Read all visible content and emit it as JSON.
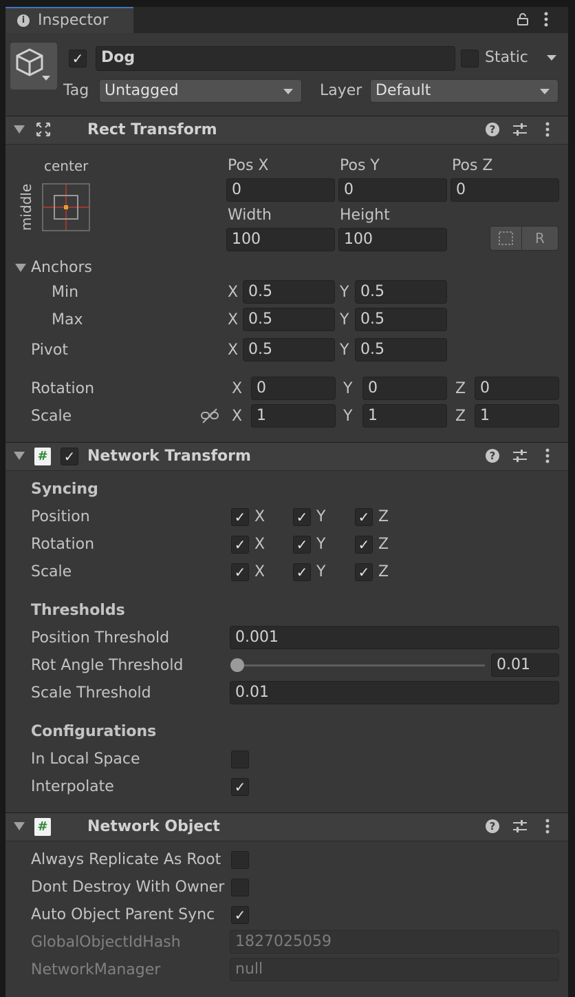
{
  "window": {
    "tab_title": "Inspector",
    "info_icon": "info-icon",
    "lock_icon": "lock-icon",
    "menu_icon": "kebab-menu-icon"
  },
  "object": {
    "name": "Dog",
    "active": true,
    "static_label": "Static",
    "static": false,
    "tag_label": "Tag",
    "tag_value": "Untagged",
    "layer_label": "Layer",
    "layer_value": "Default"
  },
  "rect_transform": {
    "title": "Rect Transform",
    "anchor_h": "center",
    "anchor_v": "middle",
    "pos_x_label": "Pos X",
    "pos_y_label": "Pos Y",
    "pos_z_label": "Pos Z",
    "pos_x": "0",
    "pos_y": "0",
    "pos_z": "0",
    "width_label": "Width",
    "height_label": "Height",
    "width": "100",
    "height": "100",
    "raw_button": "R",
    "anchors_label": "Anchors",
    "min_label": "Min",
    "max_label": "Max",
    "min_x": "0.5",
    "min_y": "0.5",
    "max_x": "0.5",
    "max_y": "0.5",
    "pivot_label": "Pivot",
    "pivot_x": "0.5",
    "pivot_y": "0.5",
    "rotation_label": "Rotation",
    "rot_x": "0",
    "rot_y": "0",
    "rot_z": "0",
    "scale_label": "Scale",
    "scale_x": "1",
    "scale_y": "1",
    "scale_z": "1",
    "x": "X",
    "y": "Y",
    "z": "Z"
  },
  "network_transform": {
    "title": "Network Transform",
    "enabled": true,
    "syncing_label": "Syncing",
    "position_label": "Position",
    "rotation_label": "Rotation",
    "scale_label": "Scale",
    "x": "X",
    "y": "Y",
    "z": "Z",
    "thresholds_label": "Thresholds",
    "position_threshold_label": "Position Threshold",
    "position_threshold": "0.001",
    "rot_angle_threshold_label": "Rot Angle Threshold",
    "rot_angle_threshold": "0.01",
    "scale_threshold_label": "Scale Threshold",
    "scale_threshold": "0.01",
    "configurations_label": "Configurations",
    "in_local_space_label": "In Local Space",
    "in_local_space": false,
    "interpolate_label": "Interpolate",
    "interpolate": true
  },
  "network_object": {
    "title": "Network Object",
    "always_replicate_label": "Always Replicate As Root",
    "always_replicate": false,
    "dont_destroy_label": "Dont Destroy With Owner",
    "dont_destroy": false,
    "auto_parent_label": "Auto Object Parent Sync",
    "auto_parent": true,
    "hash_label": "GlobalObjectIdHash",
    "hash_value": "1827025059",
    "manager_label": "NetworkManager",
    "manager_value": "null"
  },
  "colors": {
    "panel": "#383838",
    "header": "#3e3e3e",
    "field": "#2a2a2a",
    "accent": "#3a79bb",
    "script_icon_green": "#2d8a3a"
  }
}
